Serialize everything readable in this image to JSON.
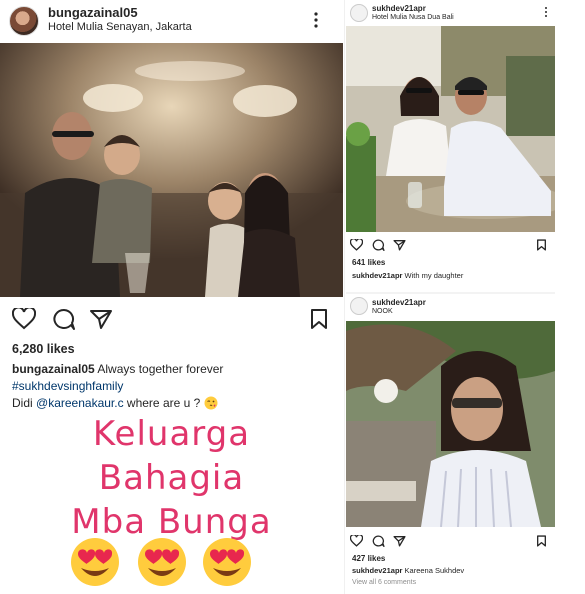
{
  "left_post": {
    "username": "bungazainal05",
    "location": "Hotel Mulia Senayan, Jakarta",
    "likes": "6,280 likes",
    "caption_user": "bungazainal05",
    "caption_text": "Always together forever",
    "hashtag": "#sukhdevsinghfamily",
    "line3_prefix": "Didi",
    "mention": "@kareenakaur.c",
    "line3_suffix": "where are u ?",
    "icons": [
      "heart-icon",
      "comment-icon",
      "share-icon",
      "bookmark-icon",
      "more-icon"
    ],
    "overlay_lines": [
      "Keluarga",
      "Bahagia",
      "Mba Bunga"
    ],
    "overlay_color": "#e0356b"
  },
  "right_top_post": {
    "username": "sukhdev21apr",
    "location": "Hotel Mulia Nusa Dua Bali",
    "likes": "641 likes",
    "caption_user": "sukhdev21apr",
    "caption_text": "With my daughter"
  },
  "right_bottom_post": {
    "username": "sukhdev21apr",
    "location": "NOOK",
    "likes": "427 likes",
    "caption_user": "sukhdev21apr",
    "caption_text": "Kareena Sukhdev",
    "comments": "View all 6 comments"
  }
}
